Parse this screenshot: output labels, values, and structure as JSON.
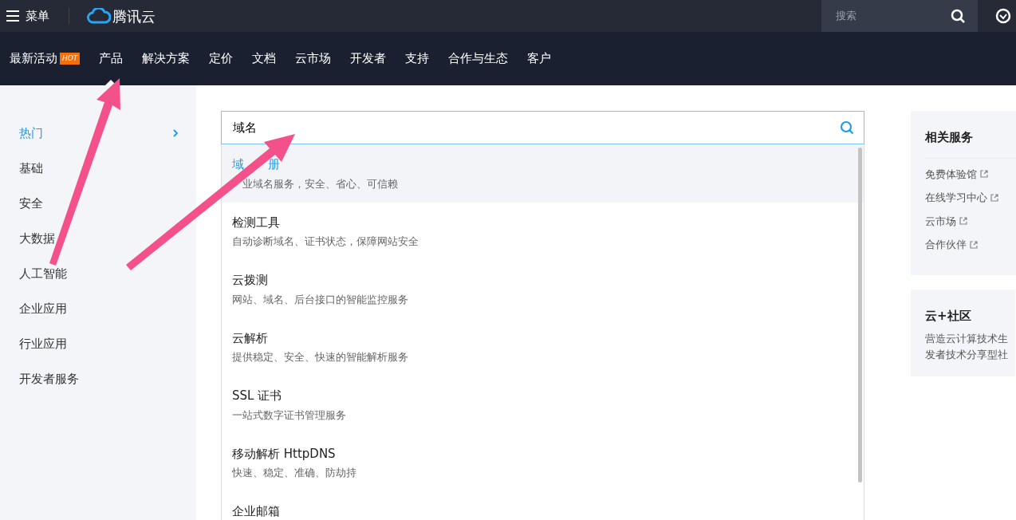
{
  "topbar": {
    "menu_label": "菜单",
    "brand": "腾讯云",
    "search": {
      "placeholder": "搜索"
    }
  },
  "nav": [
    {
      "label": "最新活动",
      "badge": "HOT",
      "selected": false
    },
    {
      "label": "产品",
      "selected": true
    },
    {
      "label": "解决方案",
      "selected": false
    },
    {
      "label": "定价",
      "selected": false
    },
    {
      "label": "文档",
      "selected": false
    },
    {
      "label": "云市场",
      "selected": false
    },
    {
      "label": "开发者",
      "selected": false
    },
    {
      "label": "支持",
      "selected": false
    },
    {
      "label": "合作与生态",
      "selected": false
    },
    {
      "label": "客户",
      "selected": false
    }
  ],
  "sidebar": {
    "items": [
      {
        "label": "热门",
        "selected": true
      },
      {
        "label": "基础",
        "selected": false
      },
      {
        "label": "安全",
        "selected": false
      },
      {
        "label": "大数据",
        "selected": false
      },
      {
        "label": "人工智能",
        "selected": false
      },
      {
        "label": "企业应用",
        "selected": false
      },
      {
        "label": "行业应用",
        "selected": false
      },
      {
        "label": "开发者服务",
        "selected": false
      }
    ]
  },
  "search": {
    "value": "域名"
  },
  "results": [
    {
      "title_parts": [
        "域",
        "册"
      ],
      "desc": "业域名服务，安全、省心、可信赖",
      "selected": true
    },
    {
      "title": "检测工具",
      "desc": "自动诊断域名、证书状态，保障网站安全",
      "selected": false
    },
    {
      "title": "云拨测",
      "desc": "网站、域名、后台接口的智能监控服务",
      "selected": false
    },
    {
      "title": "云解析",
      "desc": "提供稳定、安全、快速的智能解析服务",
      "selected": false
    },
    {
      "title": "SSL 证书",
      "desc": "一站式数字证书管理服务",
      "selected": false
    },
    {
      "title": "移动解析 HttpDNS",
      "desc": "快速、稳定、准确、防劫持",
      "selected": false
    },
    {
      "title": "企业邮箱",
      "selected": false
    }
  ],
  "related": {
    "title": "相关服务",
    "links": [
      "免费体验馆",
      "在线学习中心",
      "云市场",
      "合作伙伴"
    ]
  },
  "community": {
    "title": "云+社区",
    "lines": [
      "营造云计算技术生",
      "发者技术分享型社"
    ]
  }
}
